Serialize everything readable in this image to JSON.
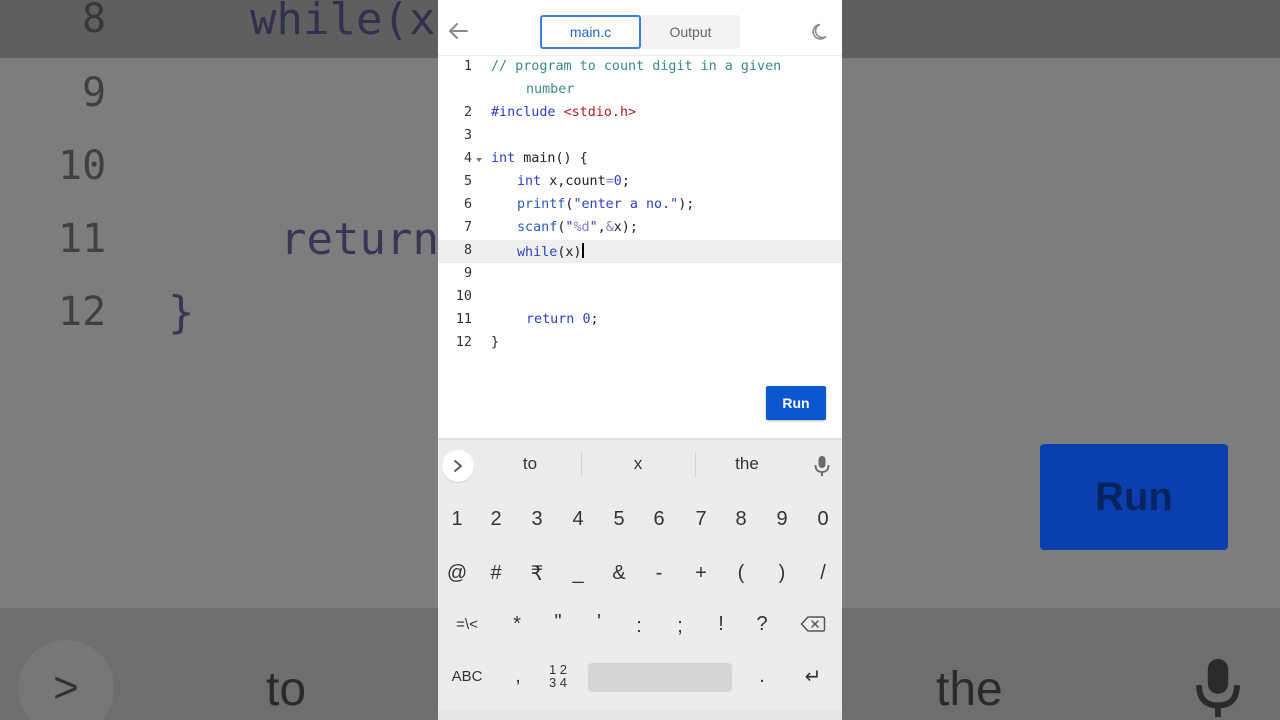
{
  "backdrop": {
    "line_numbers": [
      "8",
      "9",
      "10",
      "11",
      "12"
    ],
    "code_while": "while(x",
    "code_return": "return",
    "code_brace": "}",
    "run_label": "Run",
    "sugg": [
      "to",
      "the"
    ],
    "chev": ">"
  },
  "header": {
    "tabs": [
      {
        "label": "main.c",
        "active": true
      },
      {
        "label": "Output",
        "active": false
      }
    ],
    "icons": {
      "back": "arrow-left-icon",
      "theme": "moon-icon"
    }
  },
  "editor": {
    "language": "c",
    "current_line": 8,
    "lines": [
      {
        "n": "1",
        "text": "// program to count digit in a given"
      },
      {
        "n": "",
        "text": "number"
      },
      {
        "n": "2",
        "text": "#include <stdio.h>"
      },
      {
        "n": "3",
        "text": ""
      },
      {
        "n": "4",
        "text": "int main() {"
      },
      {
        "n": "5",
        "text": "int x,count=0;"
      },
      {
        "n": "6",
        "text": "printf(\"enter a no.\");"
      },
      {
        "n": "7",
        "text": "scanf(\"%d\",&x);"
      },
      {
        "n": "8",
        "text": "while(x)"
      },
      {
        "n": "9",
        "text": ""
      },
      {
        "n": "10",
        "text": ""
      },
      {
        "n": "11",
        "text": "return 0;"
      },
      {
        "n": "12",
        "text": "}"
      }
    ]
  },
  "run_button": {
    "label": "Run",
    "color": "#0b57d0"
  },
  "keyboard": {
    "suggestions": [
      "to",
      "x",
      "the"
    ],
    "expand": ">",
    "row1": [
      "1",
      "2",
      "3",
      "4",
      "5",
      "6",
      "7",
      "8",
      "9",
      "0"
    ],
    "row2": [
      "@",
      "#",
      "₹",
      "_",
      "&",
      "-",
      "+",
      "(",
      ")",
      "/"
    ],
    "row3": [
      "=\\<",
      "*",
      "\"",
      "'",
      ":",
      ";",
      "!",
      "?"
    ],
    "row4": {
      "abc": "ABC",
      "comma": ",",
      "numpad_top": "1 2",
      "numpad_bottom": "3 4",
      "period": ".",
      "enter": "↵"
    }
  }
}
